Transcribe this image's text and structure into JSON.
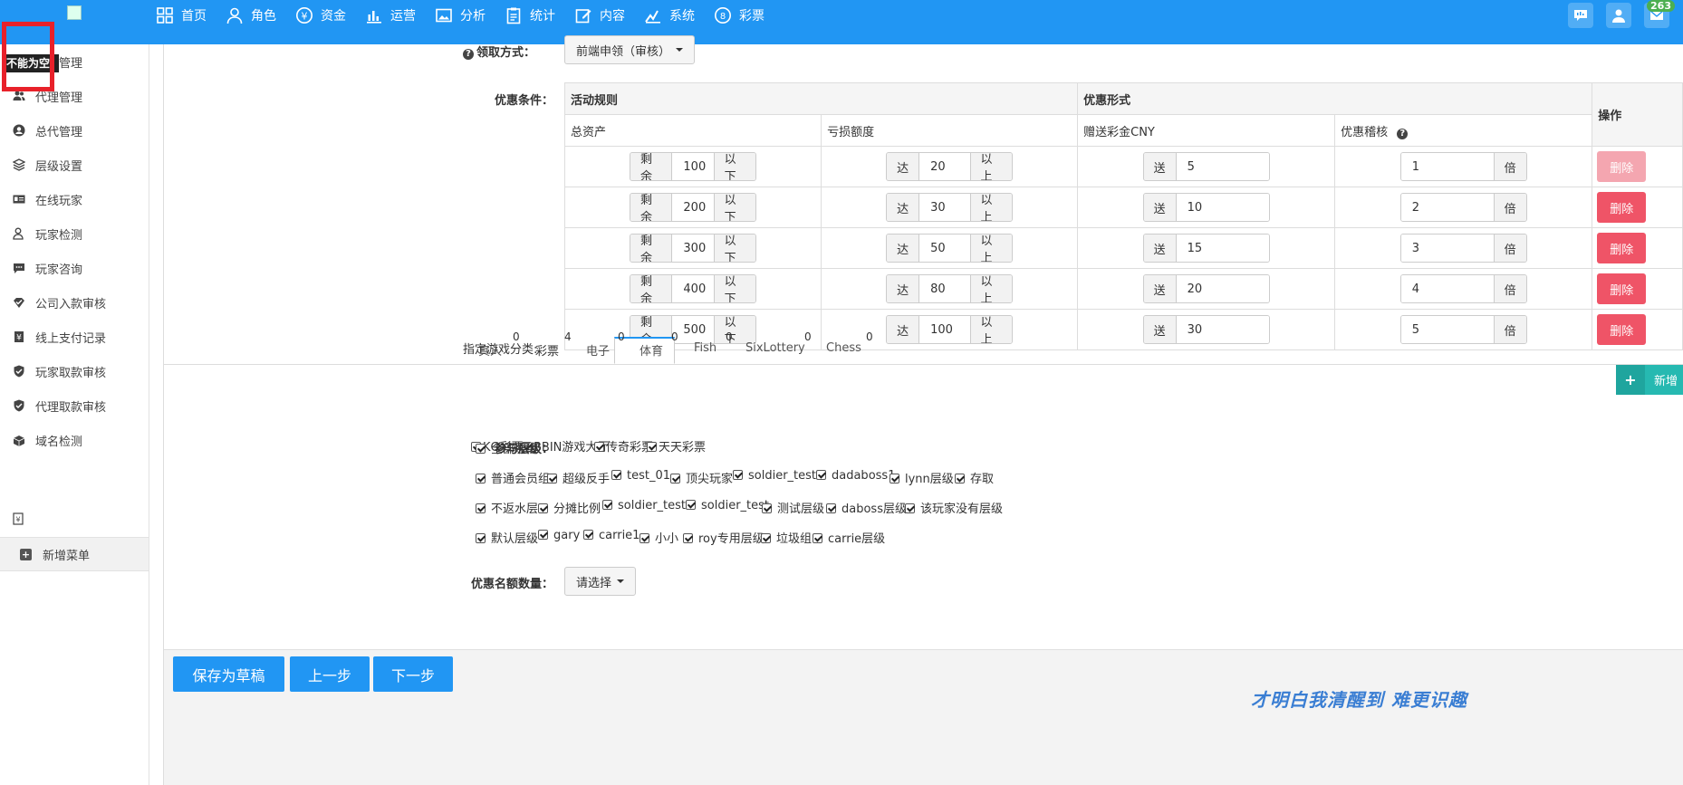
{
  "topbar": {
    "nav": [
      {
        "label": "首页",
        "icon": "grid-icon"
      },
      {
        "label": "角色",
        "icon": "user-icon"
      },
      {
        "label": "资金",
        "icon": "yen-icon"
      },
      {
        "label": "运营",
        "icon": "bar-chart-icon"
      },
      {
        "label": "分析",
        "icon": "image-icon"
      },
      {
        "label": "统计",
        "icon": "clipboard-icon"
      },
      {
        "label": "内容",
        "icon": "edit-icon"
      },
      {
        "label": "系统",
        "icon": "settings-icon"
      },
      {
        "label": "彩票",
        "icon": "lottery-icon"
      }
    ],
    "badge_count": "263"
  },
  "tooltip": "不能为空",
  "sidebar": {
    "items": [
      {
        "label": "会员管理",
        "icon": "users-icon"
      },
      {
        "label": "代理管理",
        "icon": "agents-icon"
      },
      {
        "label": "总代管理",
        "icon": "user-circle-icon"
      },
      {
        "label": "层级设置",
        "icon": "layers-icon"
      },
      {
        "label": "在线玩家",
        "icon": "id-card-icon"
      },
      {
        "label": "玩家检测",
        "icon": "user-check-icon"
      },
      {
        "label": "玩家咨询",
        "icon": "chat-icon"
      },
      {
        "label": "公司入款审核",
        "icon": "check-badge-icon"
      },
      {
        "label": "线上支付记录",
        "icon": "yen-doc-icon"
      },
      {
        "label": "玩家取款审核",
        "icon": "shield-check-icon"
      },
      {
        "label": "代理取款审核",
        "icon": "shield-check-icon"
      },
      {
        "label": "域名检测",
        "icon": "box-icon"
      }
    ],
    "add_menu": "新增菜单"
  },
  "form": {
    "claim_method_label": "领取方式：",
    "claim_method_value": "前端申领（审核）",
    "condition_label": "优惠条件：",
    "table": {
      "group1": "活动规则",
      "group2": "优惠形式",
      "action": "操作",
      "col1": "总资产",
      "col2": "亏损额度",
      "col3": "赠送彩金CNY",
      "col4": "优惠稽核",
      "rows": [
        {
          "a_pre": "剩余",
          "a_val": "100",
          "a_suf": "以下",
          "b_pre": "达",
          "b_val": "20",
          "b_suf": "以上",
          "c_pre": "送",
          "c_val": "5",
          "d_val": "1",
          "d_suf": "倍",
          "del": "删除"
        },
        {
          "a_pre": "剩余",
          "a_val": "200",
          "a_suf": "以下",
          "b_pre": "达",
          "b_val": "30",
          "b_suf": "以上",
          "c_pre": "送",
          "c_val": "10",
          "d_val": "2",
          "d_suf": "倍",
          "del": "删除"
        },
        {
          "a_pre": "剩余",
          "a_val": "300",
          "a_suf": "以下",
          "b_pre": "达",
          "b_val": "50",
          "b_suf": "以上",
          "c_pre": "送",
          "c_val": "15",
          "d_val": "3",
          "d_suf": "倍",
          "del": "删除"
        },
        {
          "a_pre": "剩余",
          "a_val": "400",
          "a_suf": "以下",
          "b_pre": "达",
          "b_val": "80",
          "b_suf": "以上",
          "c_pre": "送",
          "c_val": "20",
          "d_val": "4",
          "d_suf": "倍",
          "del": "删除"
        },
        {
          "a_pre": "剩余",
          "a_val": "500",
          "a_suf": "以下",
          "b_pre": "达",
          "b_val": "100",
          "b_suf": "以上",
          "c_pre": "送",
          "c_val": "30",
          "d_val": "5",
          "d_suf": "倍",
          "del": "删除"
        }
      ]
    },
    "add_button": "新增",
    "game_cat_label": "指定游戏分类:",
    "tabs": [
      {
        "label": "真人",
        "count": "0"
      },
      {
        "label": "彩票",
        "count": "4"
      },
      {
        "label": "电子",
        "count": "0"
      },
      {
        "label": "体育",
        "count": "0"
      },
      {
        "label": "Fish",
        "count": "0"
      },
      {
        "label": "SixLottery",
        "count": "0"
      },
      {
        "label": "Chess",
        "count": "0"
      }
    ],
    "games": [
      "KG彩票",
      "BBIN游戏大厅",
      "传奇彩票",
      "天天彩票"
    ],
    "level_label": "参与层级：",
    "levels_all": "全部层级",
    "levels_row1": [
      "普通会员组",
      "超级反手",
      "test_01",
      "顶尖玩家",
      "soldier_test2",
      "dadaboss1",
      "lynn层级",
      "存取"
    ],
    "levels_row2": [
      "不返水层",
      "分摊比例",
      "soldier_test1",
      "soldier_test",
      "测试层级",
      "daboss层级",
      "该玩家没有层级"
    ],
    "levels_row3": [
      "默认层级",
      "gary",
      "carrie1",
      "小小",
      "roy专用层级",
      "垃圾组",
      "carrie层级"
    ],
    "quota_label": "优惠名额数量：",
    "quota_value": "请选择"
  },
  "buttons": {
    "save_draft": "保存为草稿",
    "prev": "上一步",
    "next": "下一步"
  },
  "watermark": "才明白我清醒到      难更识趣"
}
